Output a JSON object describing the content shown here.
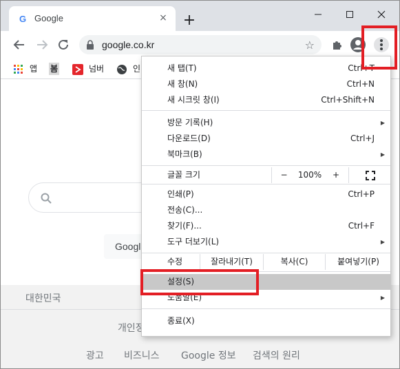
{
  "tab": {
    "title": "Google",
    "close": "×"
  },
  "new_tab": "+",
  "window_controls": {
    "minimize": "—",
    "maximize": "☐",
    "close": "✕"
  },
  "address": {
    "url": "google.co.kr"
  },
  "bookmarks": [
    {
      "label": "앱",
      "icon": "apps-grid-icon"
    },
    {
      "label": "봄",
      "icon": "bom-favicon"
    },
    {
      "label": "넘버",
      "icon": "number-favicon"
    },
    {
      "label": "인",
      "icon": "globe-icon"
    }
  ],
  "page": {
    "search_button_partial": "Google",
    "country": "대한민국",
    "privacy_partial": "개인정",
    "footer_links": [
      "광고",
      "비즈니스",
      "Google 정보",
      "검색의 원리"
    ]
  },
  "menu": {
    "group1": [
      {
        "label": "새 탭(T)",
        "shortcut": "Ctrl+T"
      },
      {
        "label": "새 창(N)",
        "shortcut": "Ctrl+N"
      },
      {
        "label": "새 시크릿 창(I)",
        "shortcut": "Ctrl+Shift+N"
      }
    ],
    "group2": [
      {
        "label": "방문 기록(H)",
        "arrow": "▶"
      },
      {
        "label": "다운로드(D)",
        "shortcut": "Ctrl+J"
      },
      {
        "label": "북마크(B)",
        "arrow": "▶"
      }
    ],
    "zoom": {
      "label": "글꼴 크기",
      "minus": "−",
      "value": "100%",
      "plus": "+"
    },
    "group3": [
      {
        "label": "인쇄(P)",
        "shortcut": "Ctrl+P"
      },
      {
        "label": "전송(C)..."
      },
      {
        "label": "찾기(F)...",
        "shortcut": "Ctrl+F"
      },
      {
        "label": "도구 더보기(L)",
        "arrow": "▶"
      }
    ],
    "edit": {
      "label": "수정",
      "cut": "잘라내기(T)",
      "copy": "복사(C)",
      "paste": "붙여넣기(P)"
    },
    "group4": [
      {
        "label": "설정(S)"
      },
      {
        "label": "도움말(E)",
        "arrow": "▶"
      }
    ],
    "exit": {
      "label": "종료(X)"
    }
  },
  "colors": {
    "highlight": "#e31e24",
    "tabstrip": "#dee1e6",
    "menu_hover": "#c8c8c8"
  }
}
